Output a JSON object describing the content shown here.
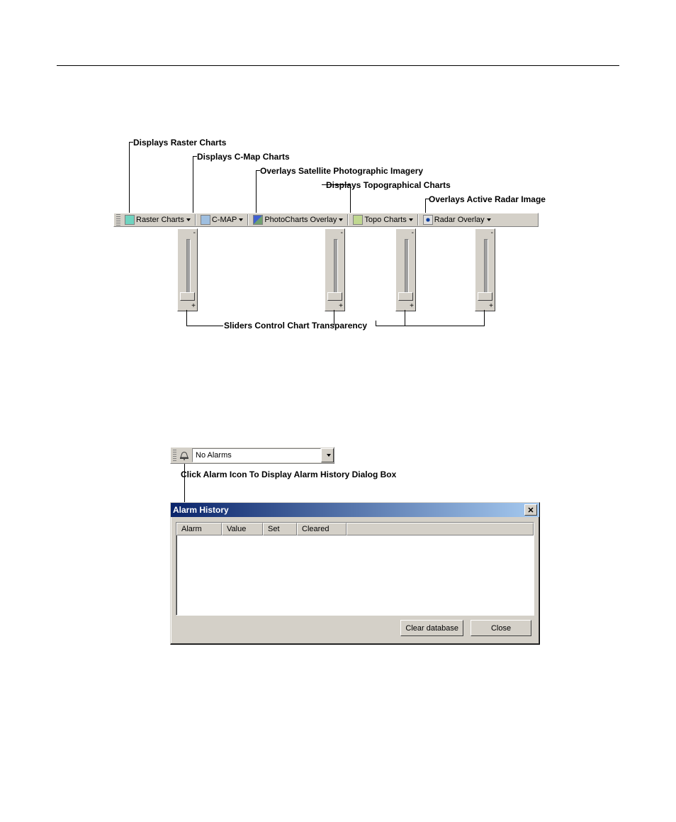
{
  "toolbar": {
    "buttons": [
      {
        "label": "Raster Charts",
        "icon_color": "#6fd4c0"
      },
      {
        "label": "C-MAP",
        "icon_color": "#9fbfe0"
      },
      {
        "label": "PhotoCharts Overlay",
        "icon_color": "#4060d0"
      },
      {
        "label": "Topo Charts",
        "icon_color": "#c0d890"
      },
      {
        "label": "Radar Overlay",
        "icon_color": "#e0e0e0"
      }
    ],
    "callouts": {
      "raster": "Displays Raster Charts",
      "cmap": "Displays C-Map Charts",
      "photo": "Overlays Satellite Photographic Imagery",
      "topo": "Displays Topographical Charts",
      "radar": "Overlays Active Radar Image",
      "sliders": "Sliders Control Chart Transparency"
    }
  },
  "alarm": {
    "field_value": "No Alarms",
    "caption": "Click Alarm Icon To Display Alarm History Dialog Box"
  },
  "dialog": {
    "title": "Alarm History",
    "columns": [
      "Alarm",
      "Value",
      "Set",
      "Cleared"
    ],
    "buttons": {
      "clear": "Clear database",
      "close": "Close"
    }
  }
}
